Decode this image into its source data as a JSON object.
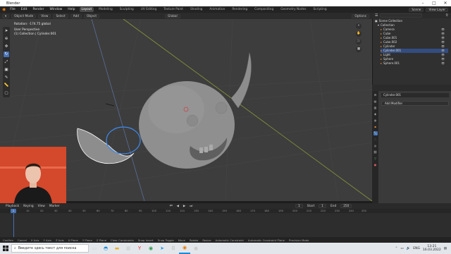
{
  "window": {
    "title": "Blender"
  },
  "menu": [
    "File",
    "Edit",
    "Render",
    "Window",
    "Help"
  ],
  "workspaces": [
    {
      "label": "Layout",
      "active": true
    },
    {
      "label": "Modeling"
    },
    {
      "label": "Sculpting"
    },
    {
      "label": "UV Editing"
    },
    {
      "label": "Texture Paint"
    },
    {
      "label": "Shading"
    },
    {
      "label": "Animation"
    },
    {
      "label": "Rendering"
    },
    {
      "label": "Compositing"
    },
    {
      "label": "Geometry Nodes"
    },
    {
      "label": "Scripting"
    }
  ],
  "topbar_right": {
    "scene": "Scene",
    "view_layer": "View Layer"
  },
  "vp_header": {
    "mode": "Object Mode",
    "view": "View",
    "select": "Select",
    "add": "Add",
    "object": "Object",
    "orientation": "Global",
    "options": "Options"
  },
  "overlay_text": {
    "line1": "Rotation: -174.75 global",
    "line2": "User Perspective",
    "line3": "(1) Collection | Cylinder.001"
  },
  "outliner": {
    "search_placeholder": "",
    "scene_collection": "Scene Collection",
    "collection": "Collection",
    "items": [
      {
        "name": "Camera",
        "selected": false
      },
      {
        "name": "Cube",
        "selected": false
      },
      {
        "name": "Cube.001",
        "selected": false
      },
      {
        "name": "Cube.002",
        "selected": false
      },
      {
        "name": "Cylinder",
        "selected": false
      },
      {
        "name": "Cylinder.001",
        "selected": true
      },
      {
        "name": "Light",
        "selected": false
      },
      {
        "name": "Sphere",
        "selected": false
      },
      {
        "name": "Sphere.001",
        "selected": false
      }
    ]
  },
  "properties": {
    "object_name": "Cylinder.001",
    "add_modifier": "Add Modifier"
  },
  "timeline": {
    "menu": [
      "Playback",
      "Keying",
      "View",
      "Marker"
    ],
    "current_frame": "1",
    "start_label": "Start",
    "start": "1",
    "end_label": "End",
    "end": "250",
    "ticks": [
      "0",
      "10",
      "20",
      "30",
      "40",
      "50",
      "60",
      "70",
      "80",
      "90",
      "100",
      "110",
      "120",
      "130",
      "140",
      "150",
      "160",
      "170",
      "180",
      "190",
      "200",
      "210",
      "220",
      "230",
      "240",
      "250"
    ]
  },
  "statusbar": [
    "Confirm",
    "Cancel",
    "X Axis",
    "Y Axis",
    "Z Axis",
    "X Plane",
    "Y Plane",
    "Z Plane",
    "Clear Constraints",
    "Snap Invert",
    "Snap Toggle",
    "Move",
    "Rotate",
    "Resize",
    "Automatic Constraint",
    "Automatic Constraint Plane",
    "Precision Mode"
  ],
  "taskbar": {
    "search_placeholder": "Введите здесь текст для поиска",
    "time": "13:21",
    "date": "16.03.2022",
    "lang": "ENG"
  },
  "colors": {
    "accent": "#4772b3",
    "viewport": "#3d3d3d",
    "selection": "#334d80"
  }
}
